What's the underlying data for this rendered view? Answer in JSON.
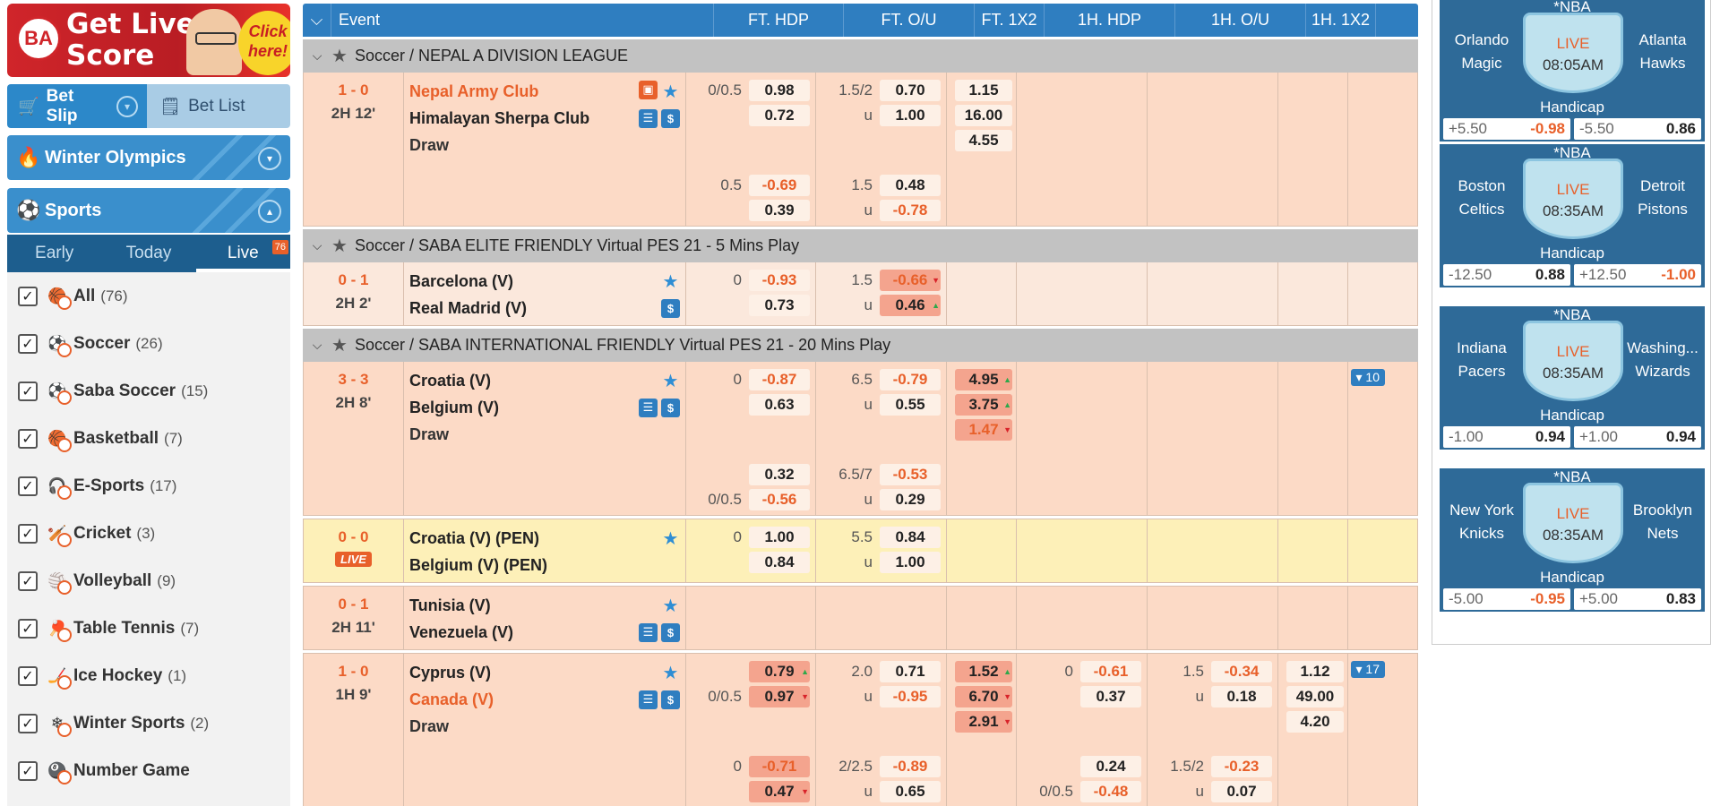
{
  "banner": {
    "text1": "Get Live",
    "text2": "Score",
    "click": "Click here!"
  },
  "betbar": {
    "slip": "Bet Slip",
    "list": "Bet List"
  },
  "winter": {
    "label": "Winter Olympics"
  },
  "sports": {
    "label": "Sports"
  },
  "tabs": [
    {
      "label": "Early"
    },
    {
      "label": "Today"
    },
    {
      "label": "Live",
      "badge": "76"
    }
  ],
  "sportlist": [
    {
      "name": "All",
      "count": "(76)",
      "icon": "🏀"
    },
    {
      "name": "Soccer",
      "count": "(26)",
      "icon": "⚽"
    },
    {
      "name": "Saba Soccer",
      "count": "(15)",
      "icon": "⚽"
    },
    {
      "name": "Basketball",
      "count": "(7)",
      "icon": "🏀"
    },
    {
      "name": "E-Sports",
      "count": "(17)",
      "icon": "🎧"
    },
    {
      "name": "Cricket",
      "count": "(3)",
      "icon": "🏏"
    },
    {
      "name": "Volleyball",
      "count": "(9)",
      "icon": "🏐"
    },
    {
      "name": "Table Tennis",
      "count": "(7)",
      "icon": "🏓"
    },
    {
      "name": "Ice Hockey",
      "count": "(1)",
      "icon": "🏒"
    },
    {
      "name": "Winter Sports",
      "count": "(2)",
      "icon": "❄"
    },
    {
      "name": "Number Game",
      "count": "",
      "icon": "🎱"
    }
  ],
  "header": {
    "event": "Event",
    "ft_hdp": "FT. HDP",
    "ft_ou": "FT. O/U",
    "ft_1x2": "FT. 1X2",
    "h1_hdp": "1H. HDP",
    "h1_ou": "1H. O/U",
    "h1_1x2": "1H. 1X2"
  },
  "leagues": {
    "l1": "Soccer / NEPAL A DIVISION LEAGUE",
    "l2": "Soccer / SABA ELITE FRIENDLY Virtual PES 21 - 5 Mins Play",
    "l3": "Soccer / SABA INTERNATIONAL FRIENDLY Virtual PES 21 - 20 Mins Play"
  },
  "m1": {
    "score": "1 - 0",
    "time": "2H 12'",
    "home": "Nepal Army Club",
    "away": "Himalayan Sherpa Club",
    "draw": "Draw",
    "hdp1": "0/0.5",
    "hdp1a": "0.98",
    "hdp1b": "0.72",
    "ou1": "1.5/2",
    "ou1a": "0.70",
    "ou1u": "u",
    "ou1b": "1.00",
    "x1": "1.15",
    "x2": "16.00",
    "x3": "4.55",
    "hdp2": "0.5",
    "hdp2a": "-0.69",
    "hdp2b": "0.39",
    "ou2": "1.5",
    "ou2a": "0.48",
    "ou2u": "u",
    "ou2b": "-0.78"
  },
  "m2": {
    "score": "0 - 1",
    "time": "2H 2'",
    "home": "Barcelona (V)",
    "away": "Real Madrid (V)",
    "hdp1": "0",
    "hdp1a": "-0.93",
    "hdp1b": "0.73",
    "ou1": "1.5",
    "ou1a": "-0.66",
    "ou1u": "u",
    "ou1b": "0.46"
  },
  "m3": {
    "score": "3 - 3",
    "time": "2H 8'",
    "home": "Croatia (V)",
    "away": "Belgium (V)",
    "draw": "Draw",
    "more": "▾ 10",
    "hdp1": "0",
    "hdp1a": "-0.87",
    "hdp1b": "0.63",
    "ou1": "6.5",
    "ou1a": "-0.79",
    "ou1u": "u",
    "ou1b": "0.55",
    "x1": "4.95",
    "x2": "3.75",
    "x3": "1.47",
    "hdp2a": "0.32",
    "hdp2": "0/0.5",
    "hdp2b": "-0.56",
    "ou2": "6.5/7",
    "ou2a": "-0.53",
    "ou2u": "u",
    "ou2b": "0.29"
  },
  "m4": {
    "score": "0 - 0",
    "live": "LIVE",
    "home": "Croatia (V) (PEN)",
    "away": "Belgium (V) (PEN)",
    "hdp1": "0",
    "hdp1a": "1.00",
    "hdp1b": "0.84",
    "ou1": "5.5",
    "ou1a": "0.84",
    "ou1u": "u",
    "ou1b": "1.00"
  },
  "m5": {
    "score": "0 - 1",
    "time": "2H 11'",
    "home": "Tunisia (V)",
    "away": "Venezuela (V)"
  },
  "m6": {
    "score": "1 - 0",
    "time": "1H 9'",
    "home": "Cyprus (V)",
    "away": "Canada (V)",
    "draw": "Draw",
    "more": "▾ 17",
    "hdp1a": "0.79",
    "hdp1": "0/0.5",
    "hdp1b": "0.97",
    "ou1": "2.0",
    "ou1a": "0.71",
    "ou1u": "u",
    "ou1b": "-0.95",
    "x1": "1.52",
    "x2": "6.70",
    "x3": "2.91",
    "h1hdp": "0",
    "h1hdpa": "-0.61",
    "h1hdpb": "0.37",
    "h1ou": "1.5",
    "h1oua": "-0.34",
    "h1ouu": "u",
    "h1oub": "0.18",
    "h1x1": "1.12",
    "h1x2": "49.00",
    "h1x3": "4.20",
    "hdp2": "0",
    "hdp2a": "-0.71",
    "hdp2b": "0.47",
    "ou2": "2/2.5",
    "ou2a": "-0.89",
    "ou2u": "u",
    "ou2b": "0.65",
    "h1hdp2a": "0.24",
    "h1hdp2": "0/0.5",
    "h1hdp2b": "-0.48",
    "h1ou2": "1.5/2",
    "h1ou2a": "-0.23",
    "h1ou2u": "u",
    "h1ou2b": "0.07"
  },
  "nba": [
    {
      "league": "*NBA",
      "l1": "Orlando",
      "l2": "Magic",
      "r1": "Atlanta",
      "r2": "Hawks",
      "live": "LIVE",
      "time": "08:05AM",
      "hc": "Handicap",
      "a": "+5.50",
      "av": "-0.98",
      "b": "-5.50",
      "bv": "0.86"
    },
    {
      "league": "*NBA",
      "l1": "Boston",
      "l2": "Celtics",
      "r1": "Detroit",
      "r2": "Pistons",
      "live": "LIVE",
      "time": "08:35AM",
      "hc": "Handicap",
      "a": "-12.50",
      "av": "0.88",
      "b": "+12.50",
      "bv": "-1.00"
    },
    {
      "league": "*NBA",
      "l1": "Indiana",
      "l2": "Pacers",
      "r1": "Washing...",
      "r2": "Wizards",
      "live": "LIVE",
      "time": "08:35AM",
      "hc": "Handicap",
      "a": "-1.00",
      "av": "0.94",
      "b": "+1.00",
      "bv": "0.94"
    },
    {
      "league": "*NBA",
      "l1": "New York",
      "l2": "Knicks",
      "r1": "Brooklyn",
      "r2": "Nets",
      "live": "LIVE",
      "time": "08:35AM",
      "hc": "Handicap",
      "a": "-5.00",
      "av": "-0.95",
      "b": "+5.00",
      "bv": "0.83"
    }
  ]
}
